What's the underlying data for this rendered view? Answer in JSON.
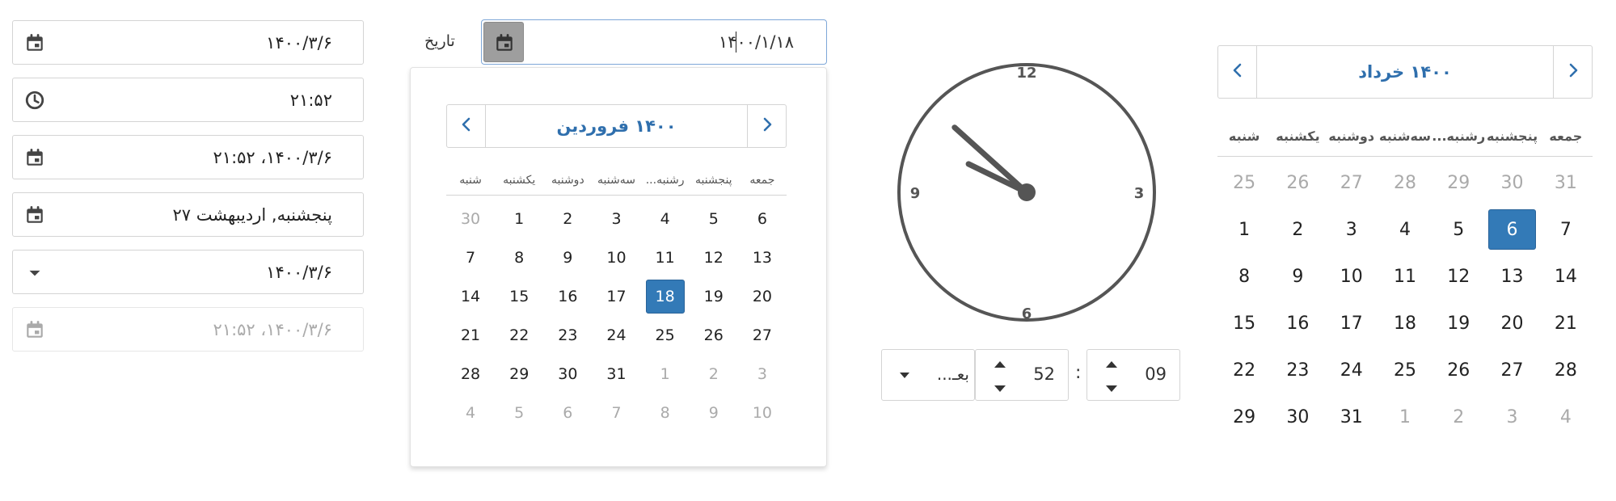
{
  "fields": [
    {
      "icon": "calendar-icon",
      "value": "۱۴۰۰/۳/۶",
      "disabled": false
    },
    {
      "icon": "clock-icon",
      "value": "۲۱:۵۲",
      "disabled": false
    },
    {
      "icon": "calendar-icon",
      "value": "۱۴۰۰/۳/۶، ۲۱:۵۲",
      "disabled": false
    },
    {
      "icon": "calendar-icon",
      "value": "پنجشنبه, اردیبهشت ۲۷",
      "disabled": false
    },
    {
      "icon": "caret-down-icon",
      "value": "۱۴۰۰/۳/۶",
      "disabled": false
    },
    {
      "icon": "calendar-icon",
      "value": "۱۴۰۰/۳/۶، ۲۱:۵۲",
      "disabled": true
    }
  ],
  "date_input": {
    "label": "تاریخ",
    "value": "۱۴۰۰/۱/۱۸"
  },
  "popup_calendar": {
    "title": "۱۴۰۰ فروردین",
    "weekdays": [
      "شنبه",
      "یکشنبه",
      "دوشنبه",
      "سه‌شنبه",
      "...رشنبه",
      "پنجشنبه",
      "جمعه"
    ],
    "days": [
      [
        "30",
        "1",
        "2",
        "3",
        "4",
        "5",
        "6"
      ],
      [
        "7",
        "8",
        "9",
        "10",
        "11",
        "12",
        "13"
      ],
      [
        "14",
        "15",
        "16",
        "17",
        "18",
        "19",
        "20"
      ],
      [
        "21",
        "22",
        "23",
        "24",
        "25",
        "26",
        "27"
      ],
      [
        "28",
        "29",
        "30",
        "31",
        "1",
        "2",
        "3"
      ],
      [
        "4",
        "5",
        "6",
        "7",
        "8",
        "9",
        "10"
      ]
    ],
    "selected": "18"
  },
  "clock": {
    "numbers": [
      "12",
      "3",
      "6",
      "9"
    ],
    "hour": 9,
    "minute": 52,
    "hour_label": "09",
    "minute_label": "52",
    "separator": ":",
    "ampm": "بعـ..."
  },
  "right_calendar": {
    "title": "۱۴۰۰ خرداد",
    "weekdays": [
      "شنبه",
      "یکشنبه",
      "دوشنبه",
      "سه‌شنبه",
      "...رشنبه",
      "پنجشنبه",
      "جمعه"
    ],
    "days": [
      [
        "25",
        "26",
        "27",
        "28",
        "29",
        "30",
        "31"
      ],
      [
        "1",
        "2",
        "3",
        "4",
        "5",
        "6",
        "7"
      ],
      [
        "8",
        "9",
        "10",
        "11",
        "12",
        "13",
        "14"
      ],
      [
        "15",
        "16",
        "17",
        "18",
        "19",
        "20",
        "21"
      ],
      [
        "22",
        "23",
        "24",
        "25",
        "26",
        "27",
        "28"
      ],
      [
        "29",
        "30",
        "31",
        "1",
        "2",
        "3",
        "4"
      ]
    ],
    "selected": "6"
  },
  "colors": {
    "accent": "#337ab7",
    "title": "#2f6fad",
    "icon": "#444444",
    "disabled": "#aaaaaa"
  }
}
